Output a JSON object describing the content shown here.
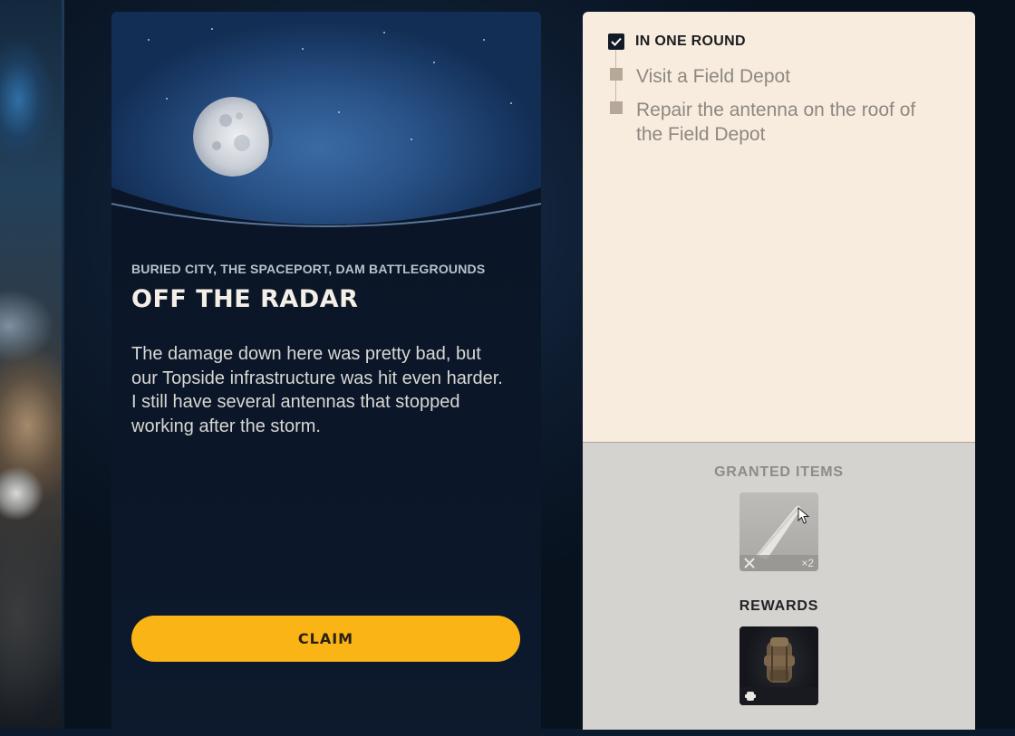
{
  "mission": {
    "locations": "BURIED CITY, THE SPACEPORT, DAM BATTLEGROUNDS",
    "title": "OFF THE RADAR",
    "description": "The damage down here was pretty bad, but our Topside infrastructure was hit even harder. I still have several antennas that stopped working after the storm.",
    "claim_label": "CLAIM"
  },
  "objectives": {
    "header": "IN ONE ROUND",
    "header_checked": true,
    "items": [
      {
        "text": "Visit a Field Depot"
      },
      {
        "text": "Repair the antenna on the roof of the Field Depot"
      }
    ]
  },
  "granted": {
    "label": "GRANTED ITEMS",
    "item": {
      "icon": "antenna-part-icon",
      "quantity": "×2",
      "type_icon": "tools-icon"
    }
  },
  "rewards": {
    "label": "REWARDS",
    "item": {
      "icon": "backpack-icon",
      "type_icon": "backpack-small-icon"
    }
  },
  "colors": {
    "accent": "#fbb415",
    "card_bg": "#0a1526",
    "objective_bg": "#f8ecdf",
    "reward_bg": "#d5d3cf"
  }
}
